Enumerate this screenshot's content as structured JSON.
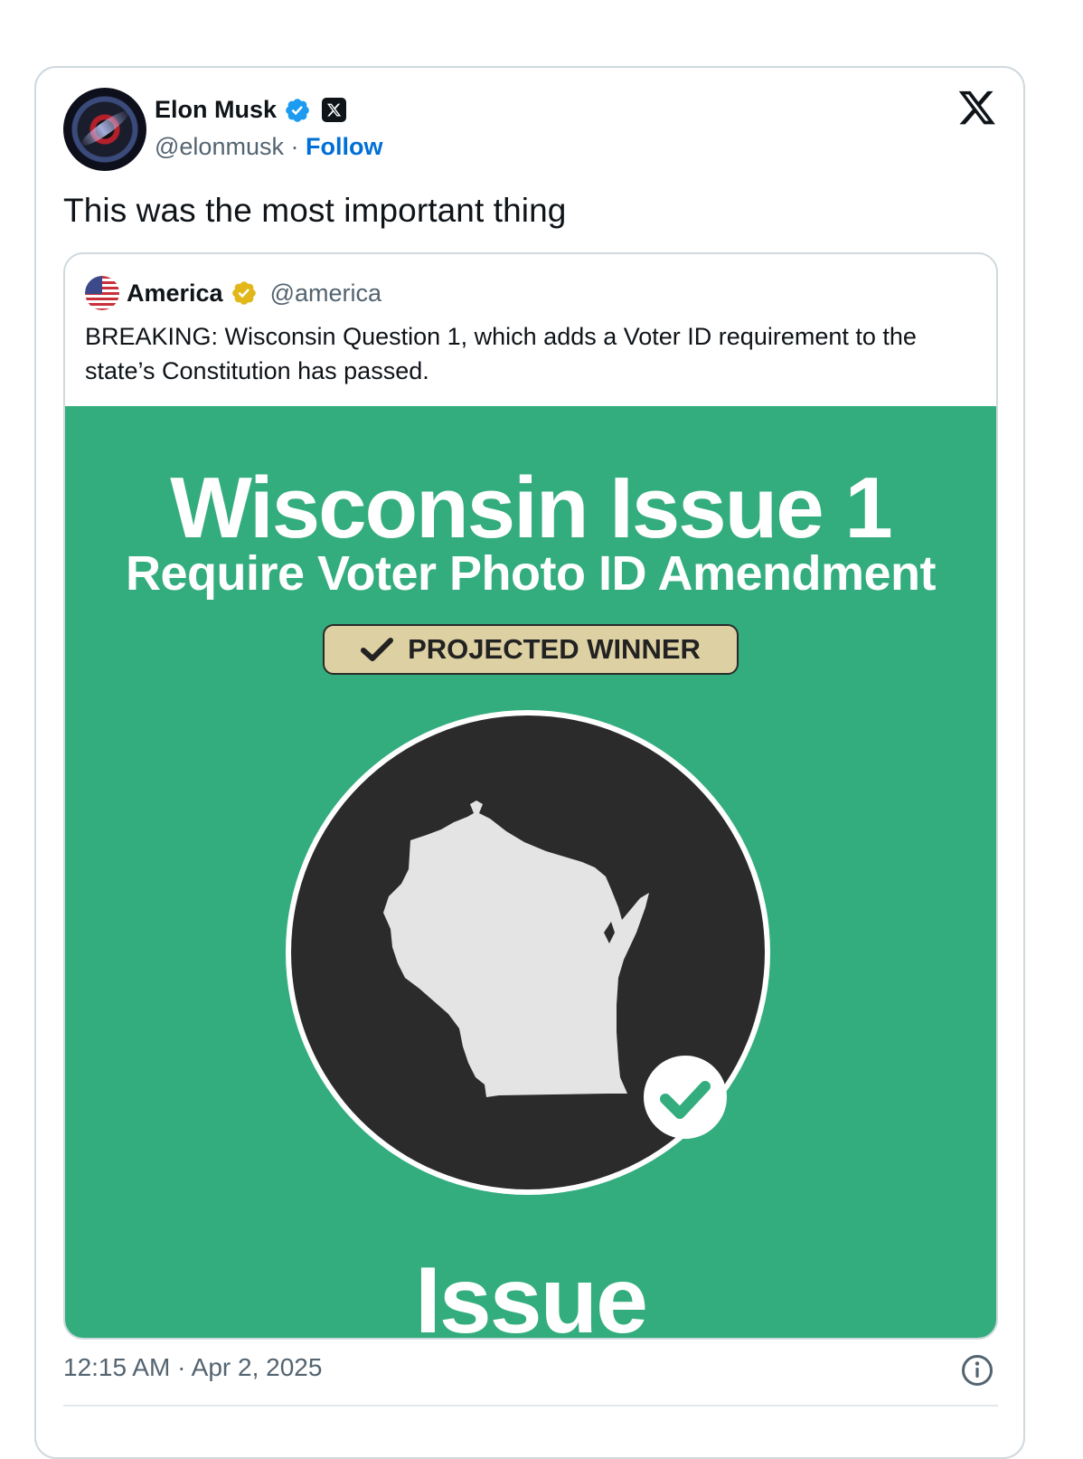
{
  "author": {
    "name": "Elon Musk",
    "handle": "@elonmusk",
    "separator": " · ",
    "follow_label": "Follow",
    "avatar_icon": "black-hole-avatar",
    "verified_icon": "blue-verified-check-icon",
    "affiliate_icon": "x-affiliate-badge-icon"
  },
  "brand": {
    "logo_icon": "x-logo-icon"
  },
  "tweet": {
    "text": "This was the most important thing"
  },
  "quote": {
    "name": "America",
    "handle": "@america",
    "avatar_icon": "us-flag-icon",
    "verified_icon": "gold-verified-check-icon",
    "text": "BREAKING: Wisconsin Question 1, which adds a Voter ID requirement to the state’s Constitution has passed.",
    "image": {
      "title": "Wisconsin Issue 1",
      "subtitle": "Require Voter Photo ID Amendment",
      "badge_label": "PROJECTED WINNER",
      "bottom_label": "Issue",
      "background_color": "#33ad7d",
      "circle_color": "#2b2b2b",
      "state_color": "#e4e4e4",
      "badge_color": "#ddd0a2"
    }
  },
  "meta": {
    "timestamp": "12:15 AM · Apr 2, 2025",
    "info_icon": "info-icon"
  },
  "colors": {
    "link_blue": "#006fd6",
    "verified_blue": "#1d9bf0",
    "verified_gold": "#e2b719",
    "secondary_text": "#536471"
  }
}
